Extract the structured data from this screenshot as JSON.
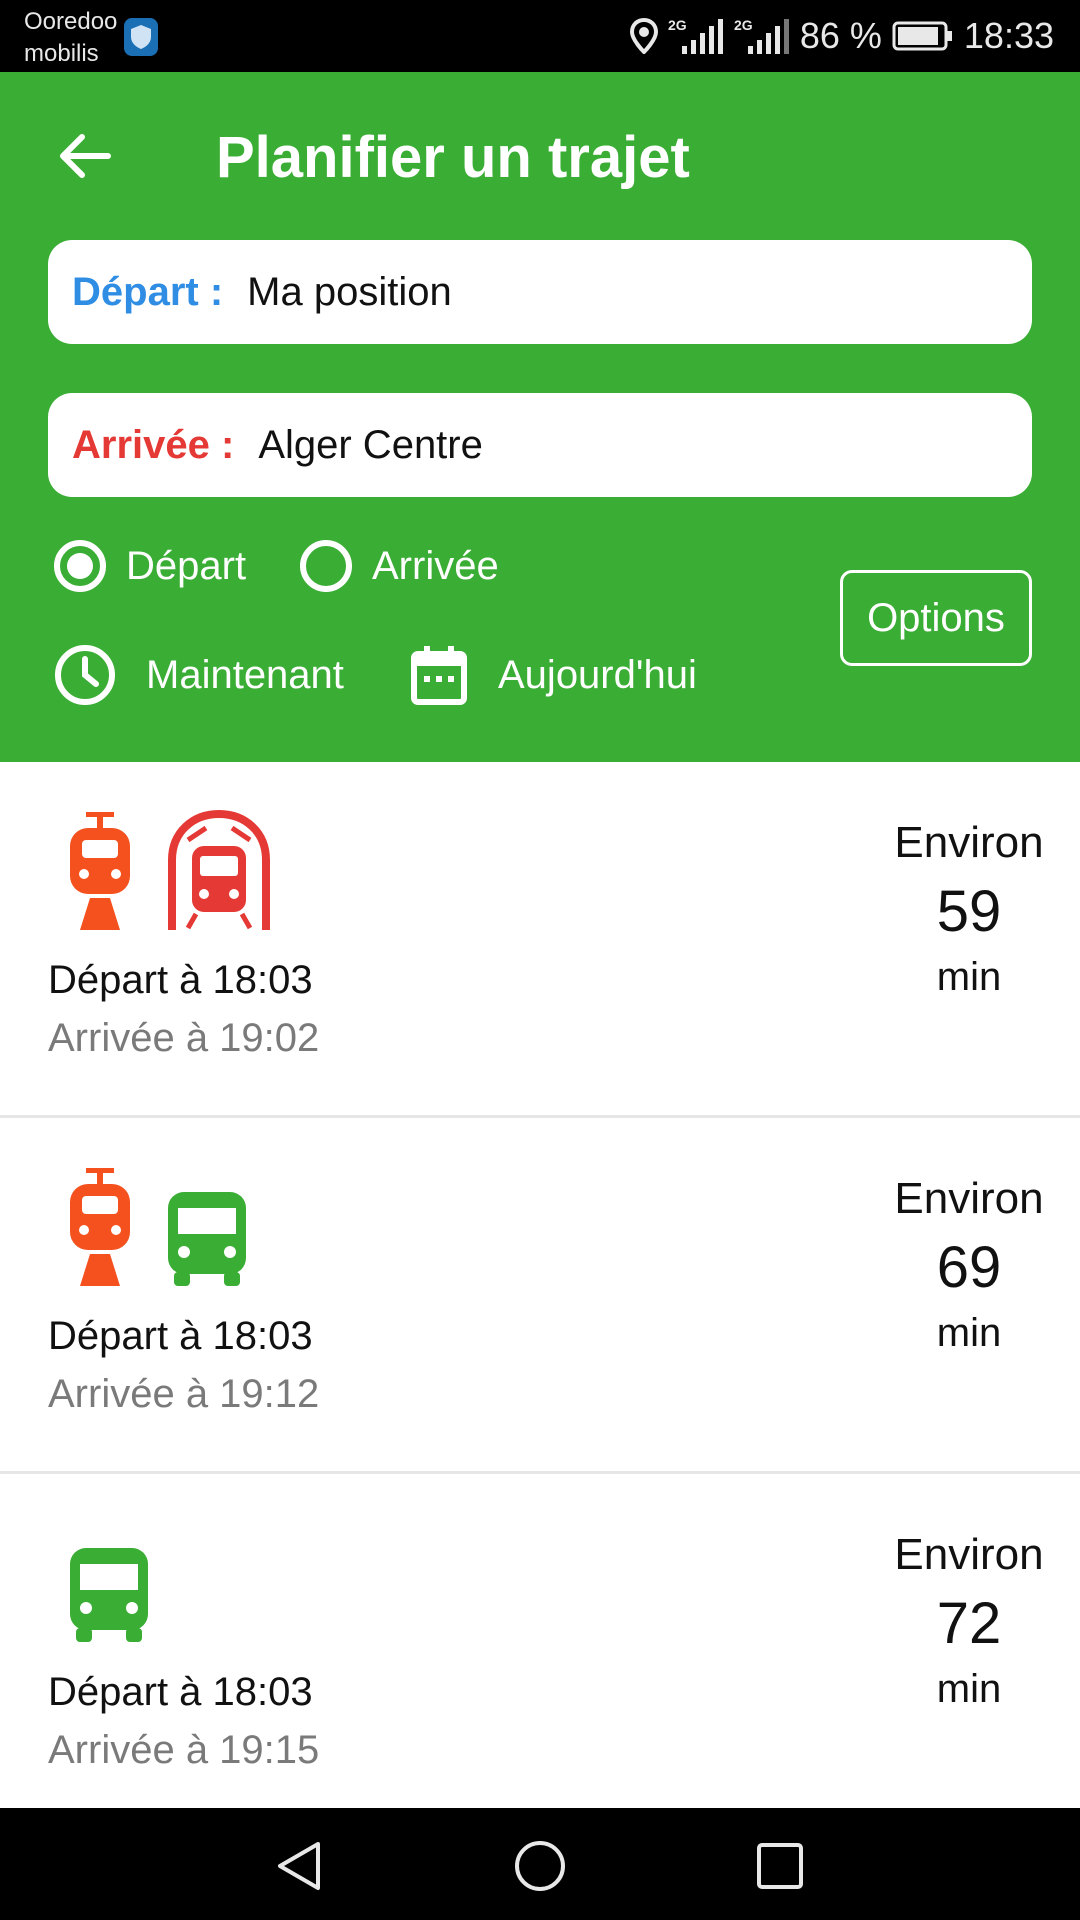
{
  "status_bar": {
    "carrier_line1": "Ooredoo",
    "carrier_line2": "mobilis",
    "network1": "2G",
    "network2": "2G",
    "battery": "86 %",
    "time": "18:33"
  },
  "header": {
    "title": "Planifier un trajet",
    "depart_label": "Départ :",
    "depart_value": "Ma position",
    "arrivee_label": "Arrivée :",
    "arrivee_value": "Alger Centre",
    "radio_depart": "Départ",
    "radio_arrivee": "Arrivée",
    "radio_selected": "depart",
    "time_label": "Maintenant",
    "date_label": "Aujourd'hui",
    "options_label": "Options"
  },
  "results": [
    {
      "modes": [
        "tram-icon",
        "metro-icon"
      ],
      "depart": "Départ à 18:03",
      "arrivee": "Arrivée à 19:02",
      "environ": "Environ",
      "duration": "59",
      "unit": "min"
    },
    {
      "modes": [
        "tram-icon",
        "bus-icon"
      ],
      "depart": "Départ à 18:03",
      "arrivee": "Arrivée à 19:12",
      "environ": "Environ",
      "duration": "69",
      "unit": "min"
    },
    {
      "modes": [
        "bus-icon"
      ],
      "depart": "Départ à 18:03",
      "arrivee": "Arrivée à 19:15",
      "environ": "Environ",
      "duration": "72",
      "unit": "min"
    }
  ],
  "colors": {
    "header_green": "#3aad35",
    "depart_blue": "#2f8de4",
    "arrivee_red": "#e53935",
    "tram_orange": "#f4511e",
    "metro_red": "#e53935",
    "bus_green": "#3aad35"
  },
  "nav": {
    "back_icon": "triangle-back-icon",
    "home_icon": "circle-home-icon",
    "recents_icon": "square-recents-icon"
  }
}
